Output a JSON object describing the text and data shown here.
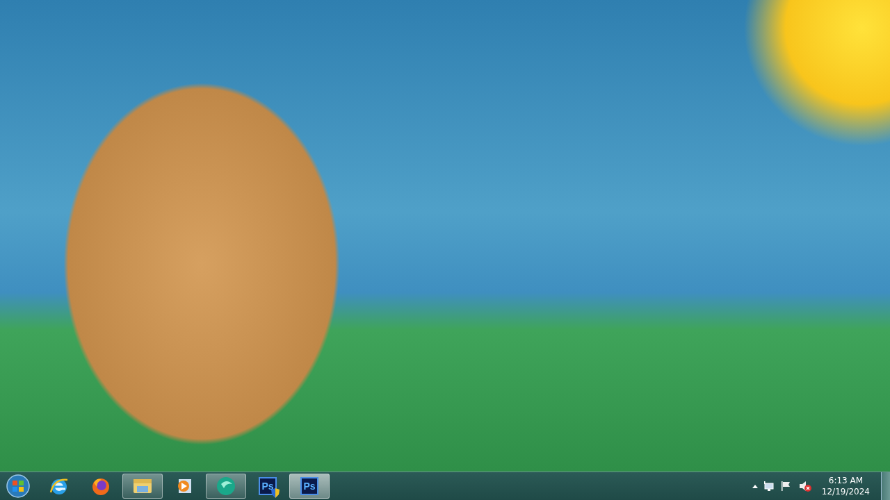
{
  "taskbar": {
    "start_button": {
      "kind": "start"
    },
    "items": [
      {
        "kind": "browser-e",
        "running": false,
        "selected": false
      },
      {
        "kind": "browser-fox",
        "running": false,
        "selected": false
      },
      {
        "kind": "folder",
        "running": true,
        "selected": false
      },
      {
        "kind": "media",
        "running": false,
        "selected": false
      },
      {
        "kind": "teal-app",
        "running": true,
        "selected": false
      },
      {
        "kind": "ps",
        "label": "Ps",
        "shield": true,
        "running": false,
        "selected": false
      },
      {
        "kind": "ps",
        "label": "Ps",
        "shield": false,
        "running": true,
        "selected": true
      }
    ],
    "tray": {
      "volume_muted": true,
      "time": "6:13 AM",
      "date": "12/19/2024"
    }
  }
}
